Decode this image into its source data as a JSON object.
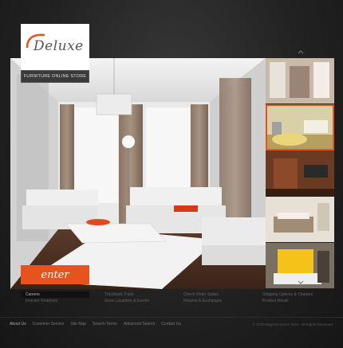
{
  "brand": {
    "logo_text": "Deluxe",
    "tagline": "FURNITURE ONLINE STORE",
    "accent": "#e8521c"
  },
  "hero": {
    "enter_label": "enter"
  },
  "gallery": {
    "thumb_count": 5,
    "up_arrow": "^",
    "down_arrow": "v"
  },
  "links": {
    "col1": [
      "Careers",
      "Investor Relations"
    ],
    "col2": [
      "Trackback Track",
      "Store Locations & Events"
    ],
    "col3": [
      "Check Order Status",
      "Returns & Exchanges"
    ],
    "col4": [
      "Shipping Options & Charges",
      "Product Recall"
    ]
  },
  "footer": {
    "nav": [
      "About Us",
      "Customer Service",
      "Site Map",
      "Search Terms",
      "Advanced Search",
      "Contact Us"
    ],
    "copyright": "© 2010 Magento Demo Store. All Rights Reserved."
  }
}
